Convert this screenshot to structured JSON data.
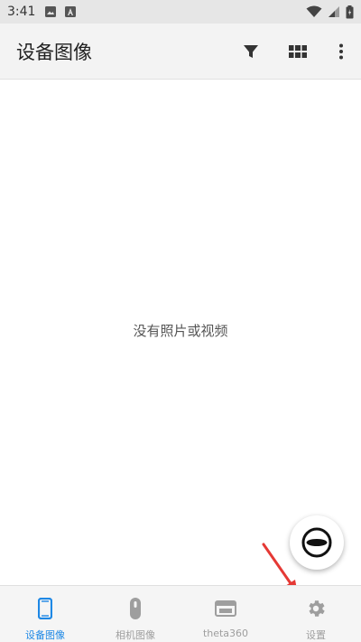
{
  "status_bar": {
    "time": "3:41"
  },
  "app_bar": {
    "title": "设备图像"
  },
  "content": {
    "empty_message": "没有照片或视频"
  },
  "bottom_nav": {
    "items": [
      {
        "label": "设备图像",
        "icon": "phone-icon",
        "active": true
      },
      {
        "label": "相机图像",
        "icon": "camera-icon",
        "active": false
      },
      {
        "label": "theta360",
        "icon": "theta-icon",
        "active": false
      },
      {
        "label": "设置",
        "icon": "gear-icon",
        "active": false
      }
    ]
  },
  "colors": {
    "accent": "#1e88e5",
    "inactive": "#9e9e9e",
    "annotation": "#e53935"
  }
}
